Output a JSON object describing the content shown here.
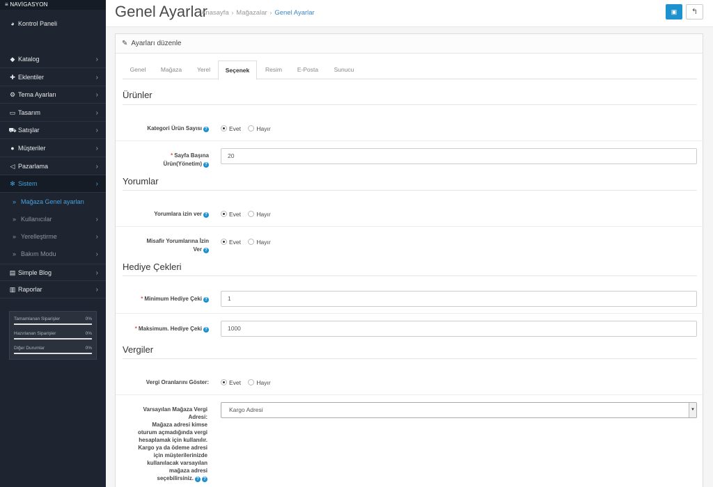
{
  "sidebar": {
    "header": "NAVİGASYON",
    "dashboard": "Kontrol Paneli",
    "items": [
      {
        "label": "Katalog",
        "icon": "tags-icon"
      },
      {
        "label": "Eklentiler",
        "icon": "puzzle-icon"
      },
      {
        "label": "Tema Ayarları",
        "icon": "cogs-icon"
      },
      {
        "label": "Tasarım",
        "icon": "monitor-icon"
      },
      {
        "label": "Satışlar",
        "icon": "cart-icon"
      },
      {
        "label": "Müşteriler",
        "icon": "user-icon"
      },
      {
        "label": "Pazarlama",
        "icon": "share-icon"
      },
      {
        "label": "Sistem",
        "icon": "gear-icon"
      }
    ],
    "sub_items": [
      {
        "label": "Mağaza Genel ayarları"
      },
      {
        "label": "Kullanıcılar"
      },
      {
        "label": "Yerelleştirme"
      },
      {
        "label": "Bakım Modu"
      }
    ],
    "lower_items": [
      {
        "label": "Simple Blog",
        "icon": "book-icon"
      },
      {
        "label": "Raporlar",
        "icon": "bar-chart-icon"
      }
    ],
    "stats": [
      {
        "label": "Tamamlanan Siparişler",
        "value": "0%"
      },
      {
        "label": "Hazırlanan Siparişler",
        "value": "0%"
      },
      {
        "label": "Diğer Durumlar",
        "value": "0%"
      }
    ]
  },
  "header": {
    "title": "Genel Ayarlar",
    "breadcrumb": [
      "Anasayfa",
      "Mağazalar",
      "Genel Ayarlar"
    ]
  },
  "panel": {
    "heading": "Ayarları düzenle",
    "tabs": [
      "Genel",
      "Mağaza",
      "Yerel",
      "Seçenek",
      "Resim",
      "E-Posta",
      "Sunucu"
    ],
    "active_tab": "Seçenek"
  },
  "form": {
    "yes": "Evet",
    "no": "Hayır",
    "sections": {
      "products": "Ürünler",
      "reviews": "Yorumlar",
      "vouchers": "Hediye Çekleri",
      "taxes": "Vergiler"
    },
    "category_product_count": {
      "label": "Kategori Ürün Sayısı",
      "value": "Evet"
    },
    "per_page": {
      "label_1": "Sayfa Başına",
      "label_2": "Ürün(Yönetim)",
      "value": "20"
    },
    "allow_reviews": {
      "label": "Yorumlara izin ver",
      "value": "Evet"
    },
    "guest_reviews": {
      "label_1": "Misafir Yorumlarına İzin",
      "label_2": "Ver",
      "value": "Evet"
    },
    "voucher_min": {
      "label": "Minimum Hediye Çeki",
      "value": "1"
    },
    "voucher_max": {
      "label": "Maksimum. Hediye Çeki",
      "value": "1000"
    },
    "show_tax": {
      "label": "Vergi Oranlarını Göster:",
      "value": "Evet"
    },
    "tax_address": {
      "label_1": "Varsayılan Mağaza Vergi",
      "label_2": "Adresi:",
      "help_lines": [
        "Mağaza adresi kimse",
        "oturum açmadığında vergi",
        "hesaplamak için kullanılır.",
        "Kargo ya da ödeme adresi",
        "için müşterilerinizde",
        "kullanılacak varsayılan",
        "mağaza adresi",
        "seçebilirsiniz."
      ],
      "value": "Kargo Adresi"
    }
  },
  "colors": {
    "sidebar_bg": "#1e2530",
    "accent": "#1e91cf",
    "active_link": "#45a1de",
    "required": "#d9534f"
  }
}
